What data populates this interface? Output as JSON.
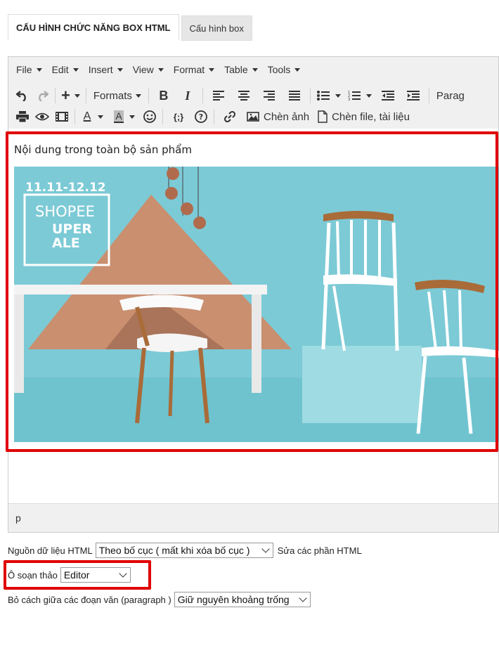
{
  "tabs": [
    "CẤU HÌNH CHỨC NĂNG BOX HTML",
    "Cấu hình box"
  ],
  "menubar": [
    "File",
    "Edit",
    "Insert",
    "View",
    "Format",
    "Table",
    "Tools"
  ],
  "toolbar": {
    "formats_label": "Formats",
    "paragraph_label": "Parag",
    "bold": "B",
    "italic": "I",
    "code_label": "{;}",
    "insert_image_label": "Chèn ảnh",
    "insert_file_label": "Chèn file, tài liệu"
  },
  "content": {
    "heading": "Nội dung trong toàn bộ sản phẩm",
    "banner": {
      "date": "11.11-12.12",
      "brand": "SHOPEE",
      "line2": "UPER",
      "line3": "ALE"
    }
  },
  "statusbar": {
    "path": "p"
  },
  "form": {
    "source_label": "Nguồn dữ liệu HTML",
    "source_value": "Theo bố cục ( mất khi xóa bố cục )",
    "source_link": "Sửa các phần HTML",
    "editor_label": "Ô soạn thảo",
    "editor_value": "Editor",
    "spacing_label": "Bỏ cách giữa các đoạn văn (paragraph )",
    "spacing_value": "Giữ nguyên khoảng trống"
  },
  "colors": {
    "highlight": "#e00000",
    "toolbar_bg": "#f0f0f0"
  }
}
